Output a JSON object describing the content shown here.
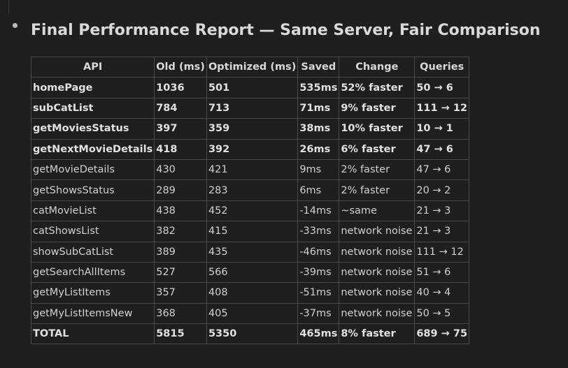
{
  "title": "Final Performance Report — Same Server, Fair Comparison",
  "table": {
    "headers": [
      "API",
      "Old (ms)",
      "Optimized (ms)",
      "Saved",
      "Change",
      "Queries"
    ],
    "rows": [
      {
        "bold": true,
        "cells": [
          "homePage",
          "1036",
          "501",
          "535ms",
          "52% faster",
          "50 → 6"
        ]
      },
      {
        "bold": true,
        "cells": [
          "subCatList",
          "784",
          "713",
          "71ms",
          "9% faster",
          "111 → 12"
        ]
      },
      {
        "bold": true,
        "cells": [
          "getMoviesStatus",
          "397",
          "359",
          "38ms",
          "10% faster",
          "10 → 1"
        ]
      },
      {
        "bold": true,
        "cells": [
          "getNextMovieDetails",
          "418",
          "392",
          "26ms",
          "6% faster",
          "47 → 6"
        ]
      },
      {
        "bold": false,
        "cells": [
          "getMovieDetails",
          "430",
          "421",
          "9ms",
          "2% faster",
          "47 → 6"
        ]
      },
      {
        "bold": false,
        "cells": [
          "getShowsStatus",
          "289",
          "283",
          "6ms",
          "2% faster",
          "20 → 2"
        ]
      },
      {
        "bold": false,
        "cells": [
          "catMovieList",
          "438",
          "452",
          "-14ms",
          "~same",
          "21 → 3"
        ]
      },
      {
        "bold": false,
        "cells": [
          "catShowsList",
          "382",
          "415",
          "-33ms",
          "network noise",
          "21 → 3"
        ]
      },
      {
        "bold": false,
        "cells": [
          "showSubCatList",
          "389",
          "435",
          "-46ms",
          "network noise",
          "111 → 12"
        ]
      },
      {
        "bold": false,
        "cells": [
          "getSearchAllItems",
          "527",
          "566",
          "-39ms",
          "network noise",
          "51 → 6"
        ]
      },
      {
        "bold": false,
        "cells": [
          "getMyListItems",
          "357",
          "408",
          "-51ms",
          "network noise",
          "40 → 4"
        ]
      },
      {
        "bold": false,
        "cells": [
          "getMyListItemsNew",
          "368",
          "405",
          "-37ms",
          "network noise",
          "50 → 5"
        ]
      },
      {
        "bold": true,
        "cells": [
          "TOTAL",
          "5815",
          "5350",
          "465ms",
          "8% faster",
          "689 → 75"
        ]
      }
    ]
  },
  "colors": {
    "background": "#1f1f1f",
    "text": "#d4d4d4",
    "border": "#4a4a4a"
  }
}
